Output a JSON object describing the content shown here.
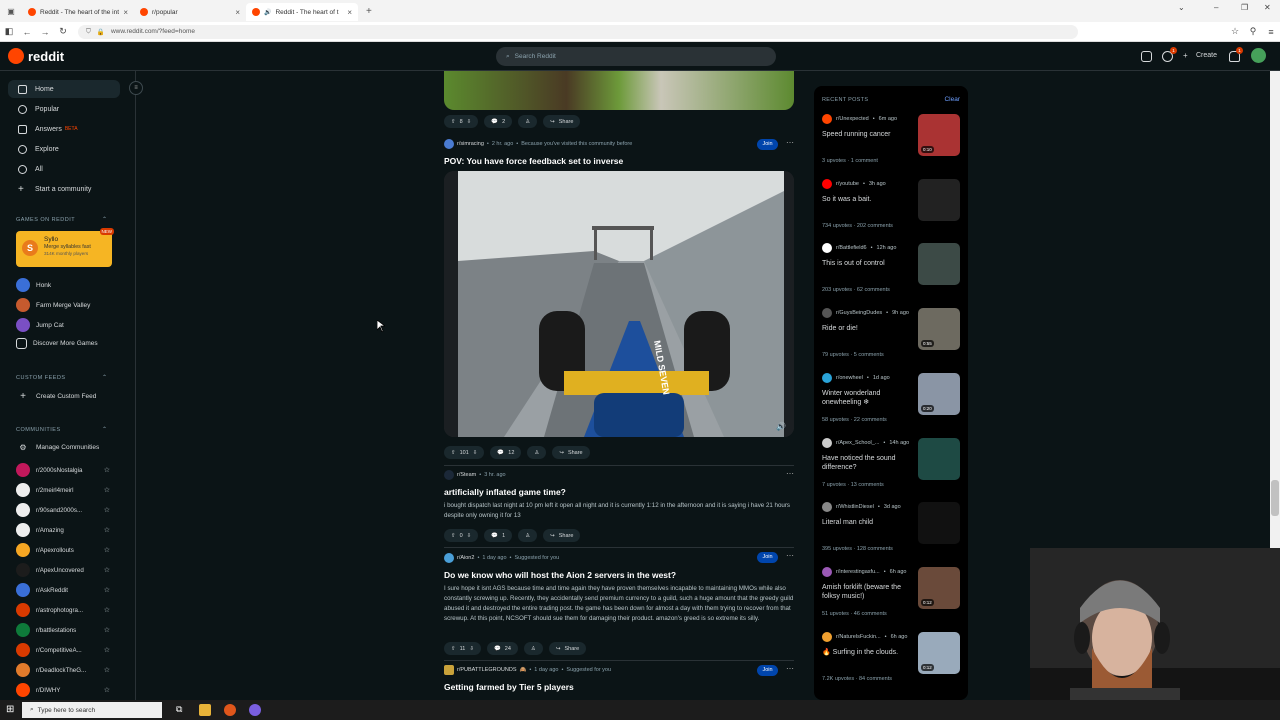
{
  "browser": {
    "tabs": [
      {
        "title": "Reddit - The heart of the intern",
        "active": false
      },
      {
        "title": "r/popular",
        "active": false
      },
      {
        "title": "Reddit - The heart of the in",
        "active": true
      }
    ],
    "url": "www.reddit.com/?feed=home"
  },
  "header": {
    "logo_text": "reddit",
    "search_placeholder": "Search Reddit",
    "create_label": "Create",
    "notif_count_1": "1",
    "notif_count_2": "1"
  },
  "sidebar": {
    "nav": [
      {
        "label": "Home",
        "icon": "home-icon"
      },
      {
        "label": "Popular",
        "icon": "popular-icon"
      },
      {
        "label": "Answers",
        "icon": "answers-icon"
      },
      {
        "label": "Explore",
        "icon": "explore-icon"
      },
      {
        "label": "All",
        "icon": "all-icon"
      },
      {
        "label": "Start a community",
        "icon": "plus-icon"
      }
    ],
    "answers_badge": "BETA",
    "games_header": "GAMES ON REDDIT",
    "featured_game": {
      "name": "Syllo",
      "desc": "Merge syllables fast",
      "players": "314K monthly players",
      "badge": "NEW"
    },
    "games": [
      "Honk",
      "Farm Merge Valley",
      "Jump Cat",
      "Discover More Games"
    ],
    "custom_feeds_header": "CUSTOM FEEDS",
    "create_custom_feed": "Create Custom Feed",
    "communities_header": "COMMUNITIES",
    "manage_communities": "Manage Communities",
    "communities": [
      "r/2000sNostalgia",
      "r/2meirl4meirl",
      "r/90sand2000s...",
      "r/Amazing",
      "r/Apexrollouts",
      "r/ApexUncovered",
      "r/AskReddit",
      "r/astrophotogra...",
      "r/battlestations",
      "r/CompetitiveA...",
      "r/DeadlockTheG...",
      "r/DIWHY"
    ]
  },
  "feed": {
    "post0": {
      "votes": "8",
      "comments": "2",
      "share": "Share"
    },
    "post1": {
      "sub": "r/simracing",
      "time": "2 hr. ago",
      "reason": "Because you've visited this community before",
      "join": "Join",
      "title": "POV: You have force feedback set to inverse",
      "votes": "101",
      "comments": "12",
      "share": "Share",
      "video_label": "MILD SEVEN"
    },
    "post2": {
      "sub": "r/Steam",
      "time": "3 hr. ago",
      "title": "artificially inflated game time?",
      "body": "i bought dispatch last night at 10 pm left it open all night and it is currently 1:12 in the afternoon and it is saying i have 21 hours despite only owning it for 13",
      "votes": "0",
      "comments": "1",
      "share": "Share"
    },
    "post3": {
      "sub": "r/Aion2",
      "time": "1 day ago",
      "reason": "Suggested for you",
      "join": "Join",
      "title": "Do we know who will host the Aion 2 servers in the west?",
      "body": "I sure hope it isnt AGS because time and time again they have proven themselves incapable to maintaining MMOs while also constantly screwing up. Recently, they accidentally send premium currency to a guild, such a huge amount that the greedy guild abused it and destroyed the entire trading post. the game has been down for almost a day with them trying to recover from that screwup. At this point, NCSOFT should sue them for damaging their product. amazon's greed is so extreme its silly.",
      "votes": "11",
      "comments": "24",
      "share": "Share"
    },
    "post4": {
      "sub": "r/PUBATTLEGROUNDS",
      "time": "1 day ago",
      "reason": "Suggested for you",
      "join": "Join",
      "title": "Getting farmed by Tier 5 players"
    }
  },
  "recent": {
    "header": "RECENT POSTS",
    "clear": "Clear",
    "items": [
      {
        "sub": "r/Unexpected",
        "time": "6m ago",
        "title": "Speed running cancer",
        "stats": "3 upvotes · 1 comment",
        "badge": "0:10",
        "color": "#a33"
      },
      {
        "sub": "r/youtube",
        "time": "3h ago",
        "title": "So it was a bait.",
        "stats": "734 upvotes · 202 comments",
        "badge": "",
        "color": "#222"
      },
      {
        "sub": "r/Battlefield6",
        "time": "12h ago",
        "title": "This is out of control",
        "stats": "203 upvotes · 62 comments",
        "badge": "",
        "color": "#3c4a46"
      },
      {
        "sub": "r/GuysBeingDudes",
        "time": "9h ago",
        "title": "Ride or die!",
        "stats": "79 upvotes · 5 comments",
        "badge": "0:55",
        "color": "#6d6a60"
      },
      {
        "sub": "r/onewheel",
        "time": "1d ago",
        "title": "Winter wonderland onewheeling ❄",
        "stats": "58 upvotes · 22 comments",
        "badge": "0:20",
        "color": "#8a95a5"
      },
      {
        "sub": "r/Apex_School_...",
        "time": "14h ago",
        "title": "Have noticed the sound difference?",
        "stats": "7 upvotes · 13 comments",
        "badge": "",
        "color": "#1e4a44"
      },
      {
        "sub": "r/WhistlinDiesel",
        "time": "3d ago",
        "title": "Literal man child",
        "stats": "395 upvotes · 128 comments",
        "badge": "",
        "color": "#111"
      },
      {
        "sub": "r/interestingasfu...",
        "time": "6h ago",
        "title": "Amish forklift (beware the folksy music!)",
        "stats": "51 upvotes · 46 comments",
        "badge": "0:12",
        "color": "#6a4a3a"
      },
      {
        "sub": "r/NaturelsFuckin...",
        "time": "6h ago",
        "title": "🔥 Surfing in the clouds.",
        "stats": "7.2K upvotes · 84 comments",
        "badge": "0:12",
        "color": "#9ab"
      }
    ]
  },
  "taskbar": {
    "search_placeholder": "Type here to search"
  }
}
